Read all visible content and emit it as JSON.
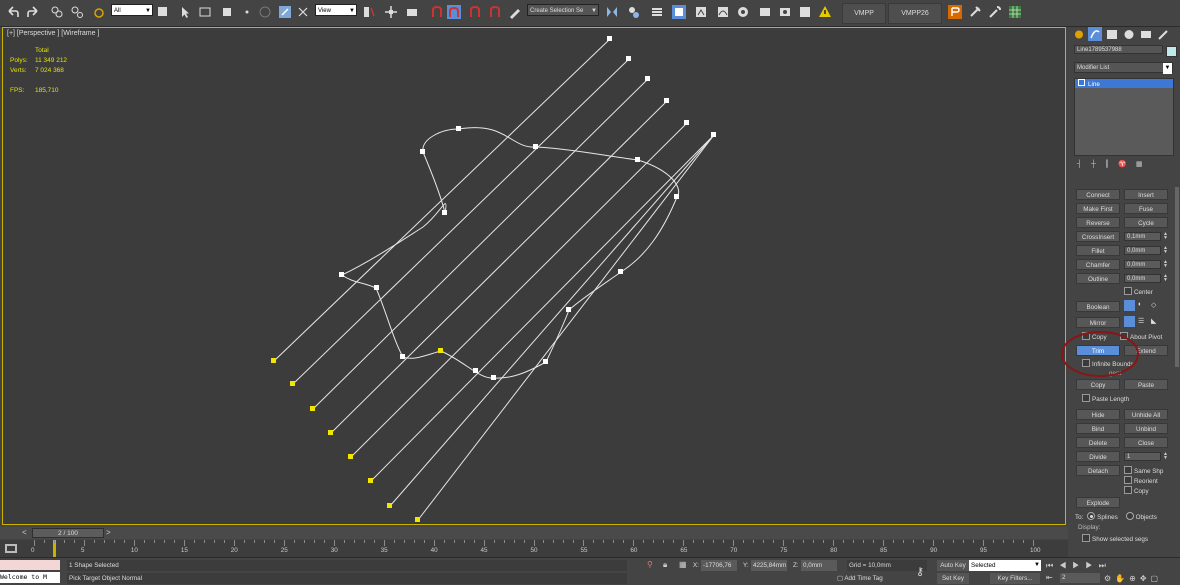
{
  "toolbar": {
    "selection_filter": "All",
    "ref_coord": "View",
    "named_selection": "Create Selection Se",
    "vmpp_label": "VMPP",
    "vmpp26_label": "VMPP26"
  },
  "viewport": {
    "label": "[+] [Perspective ] [Wireframe ]",
    "stats": {
      "total_label": "Total",
      "polys_label": "Polys:",
      "polys_value": "11 349 212",
      "verts_label": "Verts:",
      "verts_value": "7 024 368",
      "fps_label": "FPS:",
      "fps_value": "185,710"
    }
  },
  "command_panel": {
    "object_name": "Line1789537988",
    "modifier_list": "Modifier List",
    "stack_item": "Line",
    "buttons": {
      "connect": "Connect",
      "insert": "Insert",
      "make_first": "Make First",
      "fuse": "Fuse",
      "reverse": "Reverse",
      "cycle": "Cycle",
      "crossinsert": "CrossInsert",
      "fillet": "Fillet",
      "chamfer": "Chamfer",
      "outline": "Outline",
      "boolean": "Boolean",
      "mirror": "Mirror",
      "trim": "Trim",
      "extend": "Extend",
      "copy": "Copy",
      "paste": "Paste",
      "hide": "Hide",
      "unhide_all": "Unhide All",
      "bind": "Bind",
      "unbind": "Unbind",
      "delete": "Delete",
      "close": "Close",
      "divide": "Divide",
      "detach": "Detach",
      "explode": "Explode"
    },
    "fields": {
      "crossinsert": "0,1mm",
      "fillet": "0,0mm",
      "chamfer": "0,0mm",
      "outline": "0,0mm",
      "divide": "1"
    },
    "checks": {
      "center": "Center",
      "copy_mirror": "Copy",
      "about_pivot": "About Pivot",
      "infinite_bounds": "Infinite Bounds",
      "paste_length": "Paste Length",
      "same_shp": "Same Shp",
      "reorient": "Reorient",
      "copy_detach": "Copy"
    },
    "explode_to": {
      "label": "To:",
      "splines": "Splines",
      "objects": "Objects"
    },
    "display": {
      "label": "Display:",
      "show_selected": "Show selected segs"
    },
    "cut_label": "gent"
  },
  "timeline": {
    "frame": "2 / 100",
    "ticks": [
      "0",
      "5",
      "10",
      "15",
      "20",
      "25",
      "30",
      "35",
      "40",
      "45",
      "50",
      "55",
      "60",
      "65",
      "70",
      "75",
      "80",
      "85",
      "90",
      "95",
      "100"
    ]
  },
  "status": {
    "welcome": "Welcome to M",
    "selected": "1 Shape Selected",
    "prompt": "Pick Target Object Normal",
    "x_label": "X:",
    "x_value": "-17706,76",
    "y_label": "Y:",
    "y_value": "4225,84mm",
    "z_label": "Z:",
    "z_value": "0,0mm",
    "grid": "Grid = 10,0mm",
    "add_time_tag": "Add Time Tag",
    "auto_key": "Auto Key",
    "set_key": "Set Key",
    "key_mode": "Selected",
    "key_filters": "Key Filters...",
    "frame_field": "2"
  },
  "colors": {
    "viewport_bg": "#3c3c3c",
    "selection_border": "#c9b200",
    "stat_text": "#e5e300",
    "highlight_blue": "#5a8ed8",
    "annotation_red": "#8b1414"
  }
}
